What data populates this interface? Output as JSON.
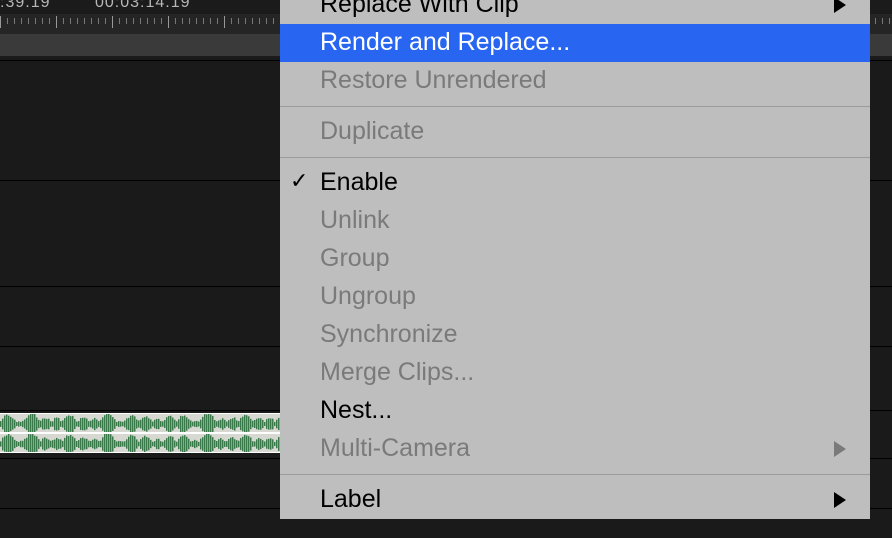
{
  "timeline": {
    "time_labels": [
      ":39.19",
      "00:03:14.19"
    ],
    "audio_clip_present": true
  },
  "context_menu": {
    "items": [
      {
        "label": "Replace With Clip",
        "enabled": true,
        "submenu": true,
        "checked": false,
        "highlighted": false
      },
      {
        "label": "Render and Replace...",
        "enabled": true,
        "submenu": false,
        "checked": false,
        "highlighted": true
      },
      {
        "label": "Restore Unrendered",
        "enabled": false,
        "submenu": false,
        "checked": false,
        "highlighted": false
      },
      {
        "sep": true
      },
      {
        "label": "Duplicate",
        "enabled": false,
        "submenu": false,
        "checked": false,
        "highlighted": false
      },
      {
        "sep": true
      },
      {
        "label": "Enable",
        "enabled": true,
        "submenu": false,
        "checked": true,
        "highlighted": false
      },
      {
        "label": "Unlink",
        "enabled": false,
        "submenu": false,
        "checked": false,
        "highlighted": false
      },
      {
        "label": "Group",
        "enabled": false,
        "submenu": false,
        "checked": false,
        "highlighted": false
      },
      {
        "label": "Ungroup",
        "enabled": false,
        "submenu": false,
        "checked": false,
        "highlighted": false
      },
      {
        "label": "Synchronize",
        "enabled": false,
        "submenu": false,
        "checked": false,
        "highlighted": false
      },
      {
        "label": "Merge Clips...",
        "enabled": false,
        "submenu": false,
        "checked": false,
        "highlighted": false
      },
      {
        "label": "Nest...",
        "enabled": true,
        "submenu": false,
        "checked": false,
        "highlighted": false
      },
      {
        "label": "Multi-Camera",
        "enabled": false,
        "submenu": true,
        "checked": false,
        "highlighted": false
      },
      {
        "sep": true
      },
      {
        "label": "Label",
        "enabled": true,
        "submenu": true,
        "checked": false,
        "highlighted": false
      }
    ]
  }
}
